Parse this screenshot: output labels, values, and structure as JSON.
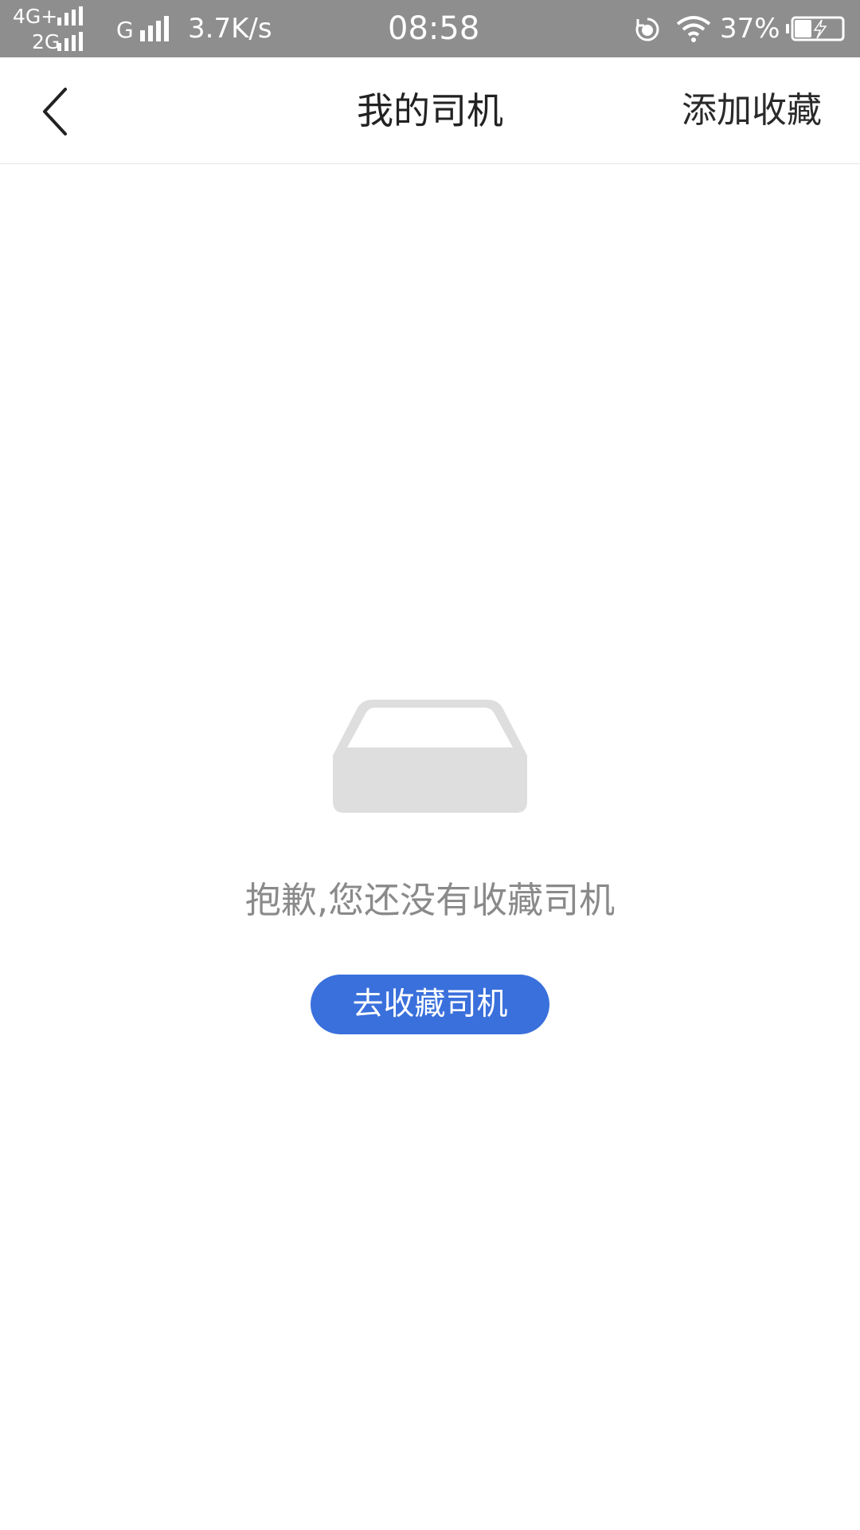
{
  "status_bar": {
    "network_primary": "4G+",
    "network_secondary": "2G",
    "network_g": "G",
    "speed": "3.7K/s",
    "time": "08:58",
    "battery_percent": "37%",
    "battery_level": 0.37,
    "charging": true,
    "icons": [
      "signal-icon",
      "rotation-lock-icon",
      "wifi-icon",
      "battery-charging-icon"
    ]
  },
  "nav": {
    "back_icon": "back-chevron-icon",
    "title": "我的司机",
    "action_label": "添加收藏"
  },
  "empty_state": {
    "icon": "empty-tray-icon",
    "message": "抱歉,您还没有收藏司机",
    "button_label": "去收藏司机"
  },
  "colors": {
    "status_bar_bg": "#8e8e8e",
    "primary_button": "#3a70dc",
    "empty_icon": "#dedede",
    "empty_text": "#8a8a8a"
  }
}
